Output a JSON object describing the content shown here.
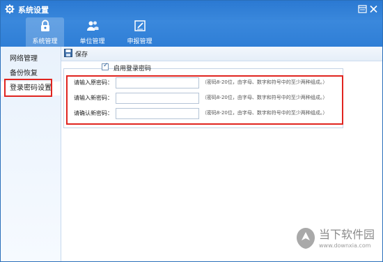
{
  "window": {
    "title": "系统设置"
  },
  "tabs": [
    {
      "label": "系统管理",
      "icon": "lock-icon",
      "active": true
    },
    {
      "label": "单位管理",
      "icon": "users-icon",
      "active": false
    },
    {
      "label": "申报管理",
      "icon": "edit-icon",
      "active": false
    }
  ],
  "sidebar": {
    "items": [
      {
        "label": "网络管理",
        "selected": false
      },
      {
        "label": "备份恢复",
        "selected": false
      },
      {
        "label": "登录密码设置",
        "selected": true
      }
    ]
  },
  "toolbar": {
    "save_label": "保存"
  },
  "form": {
    "legend_label": "启用登录密码",
    "enabled": true,
    "fields": [
      {
        "label": "请输入原密码：",
        "value": "",
        "hint": "（密码8-20位，由字母、数字和符号中的至少两种组成。）"
      },
      {
        "label": "请输入新密码：",
        "value": "",
        "hint": "（密码8-20位，由字母、数字和符号中的至少两种组成。）"
      },
      {
        "label": "请确认新密码：",
        "value": "",
        "hint": "（密码8-20位，由字母、数字和符号中的至少两种组成。）"
      }
    ]
  },
  "watermark": {
    "name": "当下软件园",
    "url": "www.downxia.com"
  },
  "colors": {
    "header_blue": "#2f7ed6",
    "highlight_red": "#e0241f",
    "sidebar_bg": "#e9f2fc"
  }
}
